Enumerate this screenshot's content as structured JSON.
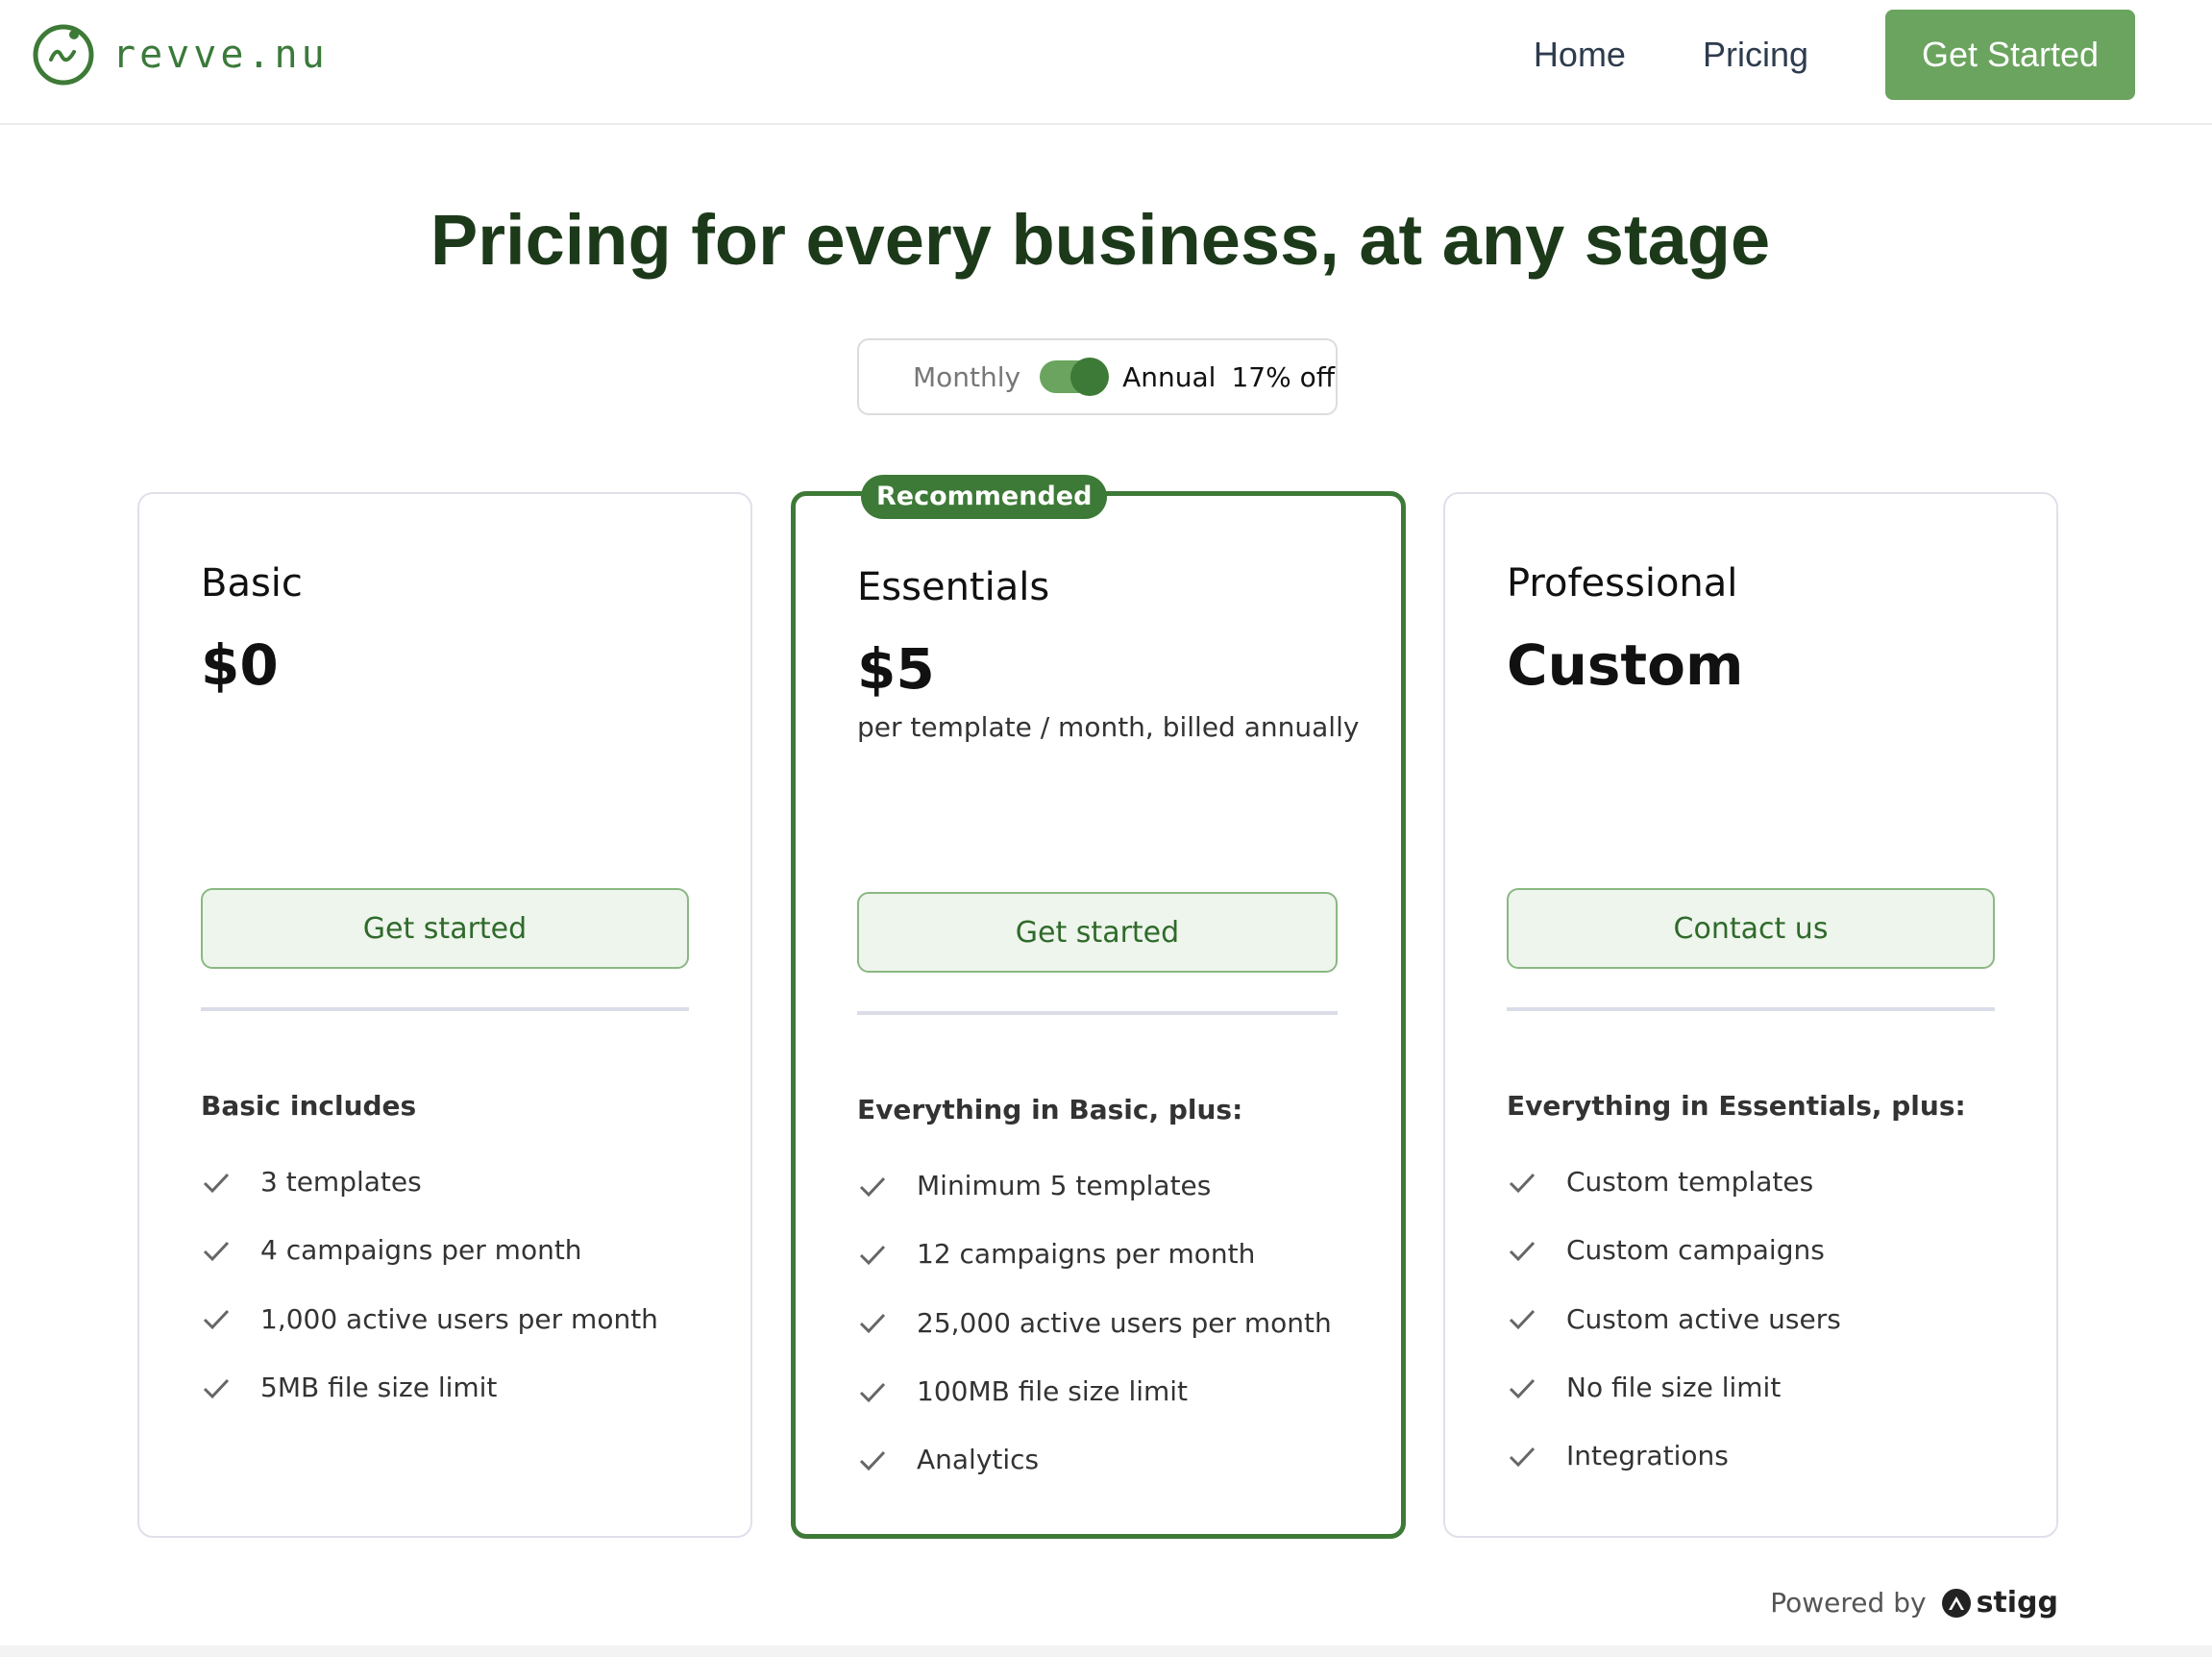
{
  "header": {
    "logo_text": "revve.nu",
    "nav": [
      {
        "label": "Home"
      },
      {
        "label": "Pricing"
      }
    ],
    "cta_label": "Get Started"
  },
  "colors": {
    "brand_green": "#3e7a37",
    "cta_green": "#6aa45e",
    "title_green": "#1c3a1a"
  },
  "main": {
    "title": "Pricing for every business, at any stage",
    "billing": {
      "monthly_label": "Monthly",
      "annual_label": "Annual",
      "discount_label": "17% off",
      "selected": "Annual"
    },
    "plans": [
      {
        "name": "Basic",
        "price": "$0",
        "note": "",
        "button": "Get started",
        "features_title": "Basic includes",
        "features": [
          "3 templates",
          "4 campaigns per month",
          "1,000 active users per month",
          "5MB file size limit"
        ]
      },
      {
        "badge": "Recommended",
        "name": "Essentials",
        "price": "$5",
        "note": "per template / month, billed annually",
        "button": "Get started",
        "features_title": "Everything in Basic, plus:",
        "features": [
          "Minimum 5 templates",
          "12 campaigns per month",
          "25,000 active users per month",
          "100MB file size limit",
          "Analytics"
        ]
      },
      {
        "name": "Professional",
        "price": "Custom",
        "note": "",
        "button": "Contact us",
        "features_title": "Everything in Essentials, plus:",
        "features": [
          "Custom templates",
          "Custom campaigns",
          "Custom active users",
          "No file size limit",
          "Integrations"
        ]
      }
    ]
  },
  "footer": {
    "powered_by": "Powered by",
    "brand": "stigg"
  },
  "icons": {
    "logo": "revve-logo-icon",
    "check": "check-icon",
    "stigg": "stigg-logo-icon"
  }
}
